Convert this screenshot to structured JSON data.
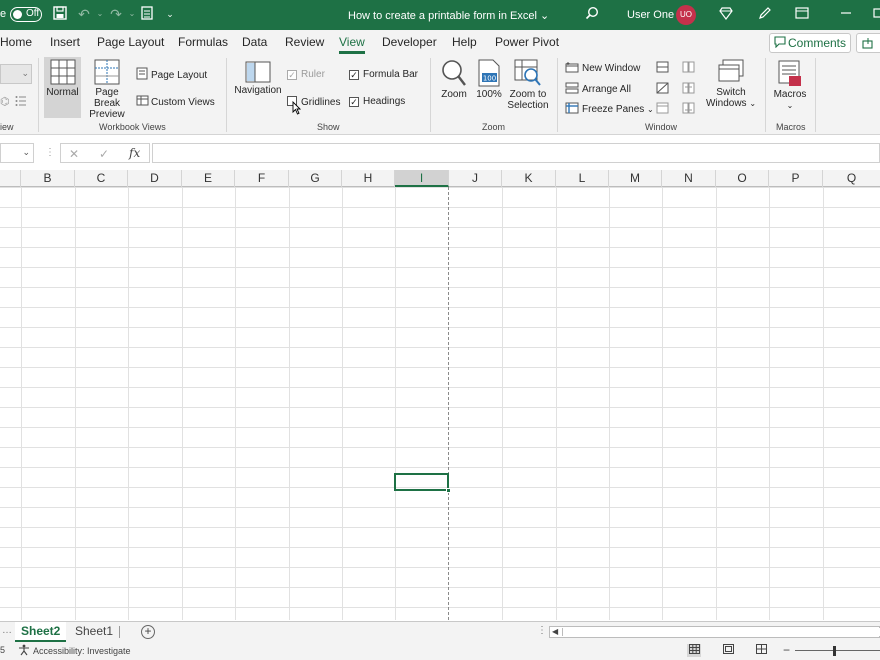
{
  "titlebar": {
    "autosave_label": "e",
    "toggle_state": "Off",
    "doc_title": "How to create a printable form in Excel",
    "user_name": "User One",
    "user_initials": "UO"
  },
  "menu": {
    "tabs": [
      "Home",
      "Insert",
      "Page Layout",
      "Formulas",
      "Data",
      "Review",
      "View",
      "Developer",
      "Help",
      "Power Pivot"
    ],
    "active_tab": "View",
    "comments_label": "Comments"
  },
  "ribbon": {
    "workbook_views": {
      "label": "Workbook Views",
      "normal": "Normal",
      "page_break_1": "Page Break",
      "page_break_2": "Preview",
      "page_layout": "Page Layout",
      "custom_views": "Custom Views"
    },
    "left_partial_label": "iew",
    "show": {
      "label": "Show",
      "navigation": "Navigation",
      "ruler": "Ruler",
      "gridlines": "Gridlines",
      "formula_bar": "Formula Bar",
      "headings": "Headings",
      "ruler_checked": true,
      "gridlines_checked": false,
      "formula_bar_checked": true,
      "headings_checked": true
    },
    "zoom": {
      "label": "Zoom",
      "zoom": "Zoom",
      "hundred": "100%",
      "zoom_sel_1": "Zoom to",
      "zoom_sel_2": "Selection"
    },
    "window": {
      "label": "Window",
      "new_window": "New Window",
      "arrange_all": "Arrange All",
      "freeze_panes": "Freeze Panes",
      "switch_1": "Switch",
      "switch_2": "Windows"
    },
    "macros": {
      "label": "Macros",
      "macros": "Macros"
    }
  },
  "formula": {
    "fx": "fx",
    "cancel": "✕",
    "enter": "✓"
  },
  "grid": {
    "columns": [
      "B",
      "C",
      "D",
      "E",
      "F",
      "G",
      "H",
      "I",
      "J",
      "K",
      "L",
      "M",
      "N",
      "O",
      "P",
      "Q"
    ],
    "selected_column": "I"
  },
  "sheets": {
    "tabs": [
      "Sheet2",
      "Sheet1"
    ],
    "active": "Sheet2",
    "add": "+"
  },
  "status": {
    "left_partial": "5",
    "accessibility": "Accessibility: Investigate"
  }
}
